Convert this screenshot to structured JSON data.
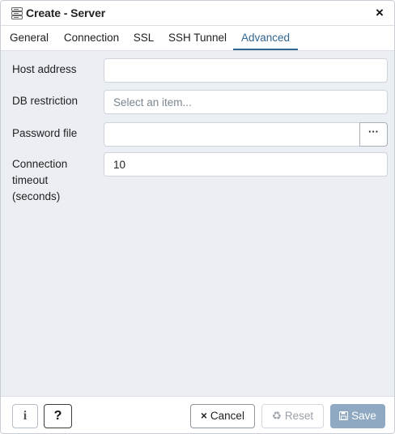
{
  "window": {
    "title": "Create - Server",
    "close_icon": "×"
  },
  "tabs": [
    {
      "label": "General",
      "active": false
    },
    {
      "label": "Connection",
      "active": false
    },
    {
      "label": "SSL",
      "active": false
    },
    {
      "label": "SSH Tunnel",
      "active": false
    },
    {
      "label": "Advanced",
      "active": true
    }
  ],
  "form": {
    "host_address": {
      "label": "Host address",
      "value": "",
      "placeholder": ""
    },
    "db_restriction": {
      "label": "DB restriction",
      "value": "",
      "placeholder": "Select an item..."
    },
    "password_file": {
      "label": "Password file",
      "value": "",
      "browse_label": "···"
    },
    "connection_timeout": {
      "label_line1": "Connection",
      "label_line2": "timeout",
      "label_line3": "(seconds)",
      "value": "10"
    }
  },
  "footer": {
    "info_label": "i",
    "help_label": "?",
    "cancel_label": "Cancel",
    "reset_label": "Reset",
    "save_label": "Save",
    "cancel_icon": "×",
    "reset_icon": "recycle-icon",
    "save_icon": "floppy-disk-icon"
  },
  "colors": {
    "accent": "#326690",
    "body_bg": "#ebeef3",
    "save_bg": "#8fa9c2"
  }
}
